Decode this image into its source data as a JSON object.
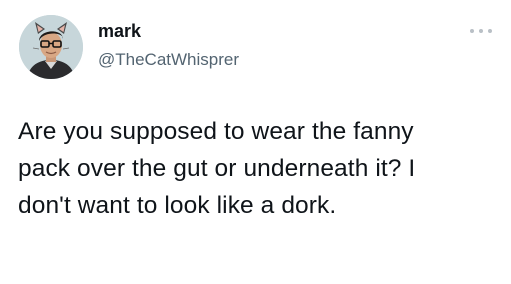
{
  "tweet": {
    "author": {
      "display_name": "mark",
      "handle": "@TheCatWhisprer",
      "avatar_icon": "profile-photo-man-with-glasses-and-cat-ears"
    },
    "more_icon": "ellipsis-horizontal-icon",
    "text_lines": [
      "Are you supposed to wear the fanny",
      "pack over the gut or underneath it? I",
      "don't want to look like a dork."
    ]
  },
  "colors": {
    "background": "#ffffff",
    "primary_text": "#0f1419",
    "secondary_text": "#536471",
    "more_dots": "#b9c0c6"
  }
}
